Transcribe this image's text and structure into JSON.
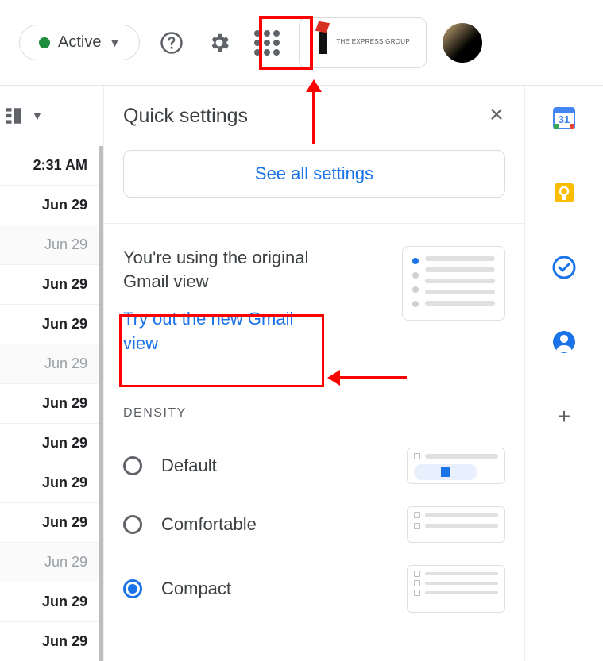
{
  "topbar": {
    "status_label": "Active",
    "org_name": "The Express Group"
  },
  "list_toggle": {
    "label": ""
  },
  "time_list": [
    {
      "text": "2:31 AM",
      "style": "bold"
    },
    {
      "text": "Jun 29",
      "style": "bold"
    },
    {
      "text": "Jun 29",
      "style": "dim"
    },
    {
      "text": "Jun 29",
      "style": "bold"
    },
    {
      "text": "Jun 29",
      "style": "bold"
    },
    {
      "text": "Jun 29",
      "style": "dim"
    },
    {
      "text": "Jun 29",
      "style": "bold"
    },
    {
      "text": "Jun 29",
      "style": "bold"
    },
    {
      "text": "Jun 29",
      "style": "bold"
    },
    {
      "text": "Jun 29",
      "style": "bold"
    },
    {
      "text": "Jun 29",
      "style": "dim"
    },
    {
      "text": "Jun 29",
      "style": "bold"
    },
    {
      "text": "Jun 29",
      "style": "bold"
    }
  ],
  "panel": {
    "title": "Quick settings",
    "see_all_label": "See all settings",
    "promo_text": "You're using the original Gmail view",
    "promo_link": "Try out the new Gmail view"
  },
  "density": {
    "title": "DENSITY",
    "options": [
      {
        "label": "Default",
        "selected": false
      },
      {
        "label": "Comfortable",
        "selected": false
      },
      {
        "label": "Compact",
        "selected": true
      }
    ]
  },
  "right_rail": {
    "calendar_day": "31"
  },
  "colors": {
    "accent": "#1a73e8",
    "highlight": "#ff0000"
  }
}
